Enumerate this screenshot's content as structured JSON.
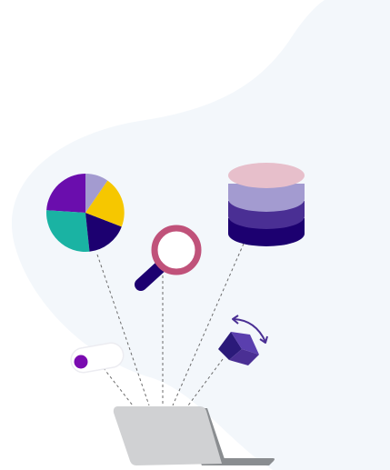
{
  "illustration": {
    "subject": "laptop-connected-to-data-tools",
    "elements": [
      "pie-chart-icon",
      "magnifier-icon",
      "database-icon",
      "cube-rotate-icon",
      "toggle-switch-icon",
      "laptop-icon"
    ],
    "colors": {
      "background_blob": "#f3f7fb",
      "pie_purple": "#6a0dad",
      "pie_lavender": "#a39bd0",
      "pie_yellow": "#f6c700",
      "pie_navy": "#1c0070",
      "pie_teal": "#1ab3a3",
      "magnifier_ring": "#c0527a",
      "magnifier_handle": "#1c0070",
      "db_pink": "#e7bfcb",
      "db_lavender": "#a39bd0",
      "db_purple": "#4a2f94",
      "db_navy": "#1c0070",
      "cube_light": "#5a3fae",
      "cube_dark": "#2b1a7a",
      "toggle_knob": "#7a0bb0",
      "laptop_screen": "#d0d1d3",
      "laptop_base": "#8a8d90",
      "connector_line": "#6b6b6b"
    }
  }
}
